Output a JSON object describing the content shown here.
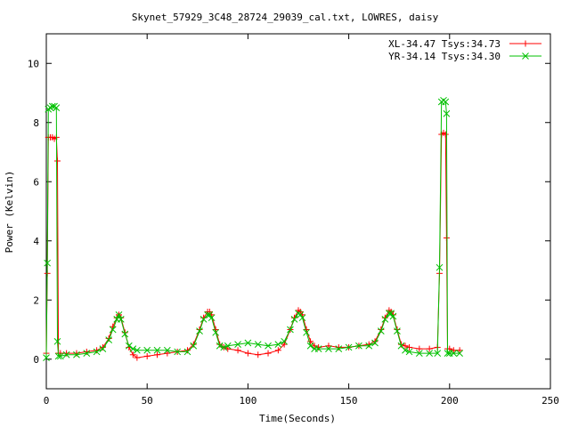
{
  "chart_data": {
    "type": "line",
    "title": "Skynet_57929_3C48_28724_29039_cal.txt, LOWRES, daisy",
    "xlabel": "Time(Seconds)",
    "ylabel": "Power (Kelvin)",
    "xlim": [
      0,
      250
    ],
    "ylim": [
      -1,
      11
    ],
    "xticks": [
      0,
      50,
      100,
      150,
      200,
      250
    ],
    "yticks": [
      0,
      2,
      4,
      6,
      8,
      10
    ],
    "grid": false,
    "legend_position": "top-right",
    "series": [
      {
        "name": "XL-34.47 Tsys:34.73",
        "color": "#ff0000",
        "marker": "plus",
        "x": [
          0,
          0.5,
          1,
          2,
          3,
          4,
          5,
          5.5,
          6,
          7,
          10,
          15,
          20,
          25,
          28,
          31,
          33,
          35,
          36,
          37,
          39,
          41,
          43,
          45,
          50,
          55,
          60,
          65,
          70,
          73,
          76,
          78,
          80,
          81,
          82,
          84,
          86,
          88,
          90,
          95,
          100,
          105,
          110,
          115,
          118,
          121,
          123,
          125,
          126,
          127,
          129,
          131,
          133,
          135,
          140,
          145,
          150,
          155,
          160,
          163,
          166,
          168,
          170,
          171,
          172,
          174,
          176,
          178,
          180,
          185,
          190,
          194,
          195,
          196,
          197,
          198,
          198.5,
          199,
          200,
          202,
          205
        ],
        "y": [
          0.2,
          2.9,
          7.5,
          7.5,
          7.5,
          7.45,
          7.5,
          6.7,
          0.2,
          0.2,
          0.2,
          0.2,
          0.25,
          0.3,
          0.4,
          0.7,
          1.1,
          1.4,
          1.5,
          1.4,
          0.9,
          0.4,
          0.15,
          0.05,
          0.1,
          0.15,
          0.2,
          0.25,
          0.3,
          0.5,
          1.0,
          1.4,
          1.6,
          1.6,
          1.5,
          1.0,
          0.5,
          0.4,
          0.35,
          0.3,
          0.2,
          0.15,
          0.2,
          0.3,
          0.5,
          1.0,
          1.4,
          1.65,
          1.6,
          1.5,
          1.0,
          0.6,
          0.45,
          0.4,
          0.45,
          0.4,
          0.4,
          0.45,
          0.5,
          0.6,
          1.0,
          1.4,
          1.65,
          1.6,
          1.5,
          1.0,
          0.5,
          0.45,
          0.4,
          0.35,
          0.35,
          0.4,
          2.9,
          7.6,
          7.65,
          7.6,
          4.1,
          0.35,
          0.35,
          0.3,
          0.3
        ]
      },
      {
        "name": "YR-34.14 Tsys:34.30",
        "color": "#00c000",
        "marker": "cross",
        "x": [
          0,
          0.5,
          1,
          2,
          3,
          4,
          5,
          5.5,
          6,
          7,
          10,
          15,
          20,
          25,
          28,
          31,
          33,
          35,
          36,
          37,
          39,
          41,
          43,
          45,
          50,
          55,
          60,
          65,
          70,
          73,
          76,
          78,
          80,
          81,
          82,
          84,
          86,
          88,
          90,
          95,
          100,
          105,
          110,
          115,
          118,
          121,
          123,
          125,
          126,
          127,
          129,
          131,
          133,
          135,
          140,
          145,
          150,
          155,
          160,
          163,
          166,
          168,
          170,
          171,
          172,
          174,
          176,
          178,
          180,
          185,
          190,
          194,
          195,
          196,
          197,
          198,
          198.5,
          199,
          200,
          202,
          205
        ],
        "y": [
          0.05,
          3.25,
          8.45,
          8.5,
          8.55,
          8.55,
          8.5,
          0.6,
          0.1,
          0.1,
          0.15,
          0.15,
          0.2,
          0.25,
          0.35,
          0.65,
          1.0,
          1.35,
          1.5,
          1.35,
          0.85,
          0.45,
          0.35,
          0.3,
          0.3,
          0.3,
          0.3,
          0.25,
          0.25,
          0.45,
          0.95,
          1.35,
          1.5,
          1.5,
          1.4,
          0.9,
          0.45,
          0.4,
          0.45,
          0.5,
          0.55,
          0.5,
          0.45,
          0.5,
          0.6,
          1.0,
          1.35,
          1.55,
          1.5,
          1.4,
          0.9,
          0.45,
          0.35,
          0.35,
          0.35,
          0.35,
          0.4,
          0.45,
          0.45,
          0.55,
          0.95,
          1.35,
          1.55,
          1.55,
          1.45,
          0.95,
          0.45,
          0.3,
          0.25,
          0.2,
          0.2,
          0.2,
          3.1,
          8.7,
          8.75,
          8.7,
          8.3,
          0.2,
          0.2,
          0.2,
          0.2
        ]
      }
    ]
  }
}
